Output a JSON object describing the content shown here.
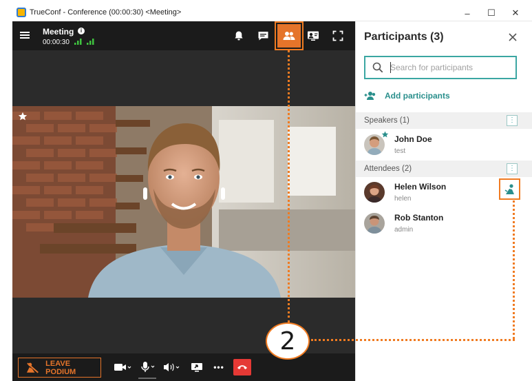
{
  "window": {
    "title": "TrueConf - Conference (00:00:30) <Meeting>",
    "controls": {
      "minimize": "–",
      "maximize": "☐",
      "close": "✕"
    }
  },
  "meeting": {
    "title": "Meeting",
    "info_glyph": "i",
    "timer": "00:00:30"
  },
  "toolbar_icons": [
    "bell-icon",
    "chat-icon",
    "participants-icon",
    "content-share-icon",
    "fullscreen-icon"
  ],
  "video": {
    "pinned_icon": "star-icon"
  },
  "controls": {
    "leave_podium": "LEAVE PODIUM",
    "more": "•••"
  },
  "panel": {
    "title": "Participants (3)",
    "search": {
      "placeholder": "Search for participants",
      "value": ""
    },
    "add_participants": "Add participants",
    "sections": [
      {
        "label": "Speakers (1)",
        "members": [
          {
            "name": "John Doe",
            "login": "test"
          }
        ]
      },
      {
        "label": "Attendees (2)",
        "members": [
          {
            "name": "Helen Wilson",
            "login": "helen"
          },
          {
            "name": "Rob Stanton",
            "login": "admin"
          }
        ]
      }
    ]
  },
  "callout": {
    "number": "2"
  },
  "colors": {
    "accent_orange": "#f07b21",
    "teal": "#3aa6a2",
    "hangup_red": "#e53935",
    "toolbar_dark": "#1b1b1b",
    "signal_green": "#3fc33f"
  }
}
